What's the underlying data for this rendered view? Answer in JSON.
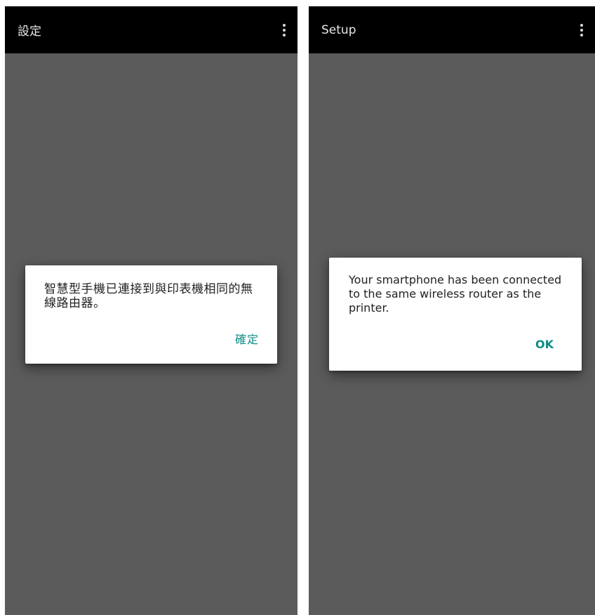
{
  "screens": [
    {
      "appbar": {
        "title": "設定"
      },
      "dialog": {
        "message": "智慧型手機已連接到與印表機相同的無線路由器。",
        "ok_label": "確定"
      }
    },
    {
      "appbar": {
        "title": "Setup"
      },
      "dialog": {
        "message": "Your smartphone has been connected to the same wireless router as the printer.",
        "ok_label": "OK"
      }
    }
  ],
  "icons": {
    "overflow_menu": "more-vert-icon"
  },
  "colors": {
    "appbar_bg": "#000000",
    "screen_scrim": "#5b5b5b",
    "dialog_bg": "#ffffff",
    "accent": "#0b8b86",
    "message_text": "#222222"
  }
}
